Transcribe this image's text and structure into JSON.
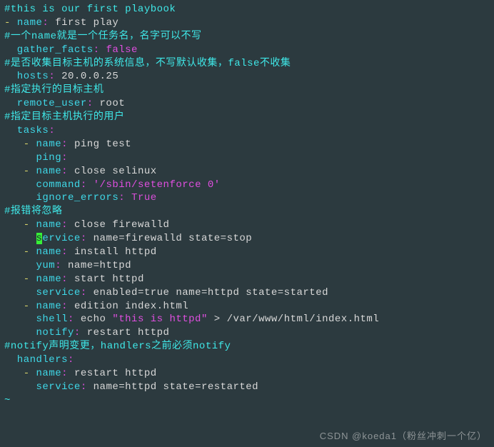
{
  "lines": {
    "l1": "#this is our first playbook",
    "l2a": "- ",
    "l2b": "name",
    "l2c": ": ",
    "l2d": "first play",
    "l3": "#一个name就是一个任务名，名字可以不写",
    "l4a": "  gather_facts",
    "l4b": ": ",
    "l4c": "false",
    "l5": "#是否收集目标主机的系统信息，不写默认收集，false不收集",
    "l6a": "  hosts",
    "l6b": ": ",
    "l6c": "20.0.0.25",
    "l7": "#指定执行的目标主机",
    "l8a": "  remote_user",
    "l8b": ": ",
    "l8c": "root",
    "l9": "#指定目标主机执行的用户",
    "l10a": "  tasks",
    "l10b": ":",
    "l11a": "   - ",
    "l11b": "name",
    "l11c": ": ",
    "l11d": "ping test",
    "l12a": "     ping",
    "l12b": ":",
    "l13a": "   - ",
    "l13b": "name",
    "l13c": ": ",
    "l13d": "close selinux",
    "l14a": "     command",
    "l14b": ": ",
    "l14c": "'/sbin/setenforce 0'",
    "l15a": "     ignore_errors",
    "l15b": ": ",
    "l15c": "True",
    "l16": "#报错将忽略",
    "l17a": "   - ",
    "l17b": "name",
    "l17c": ": ",
    "l17d": "close firewalld",
    "l18a": "     ",
    "l18cur": "s",
    "l18b": "ervice",
    "l18c": ": ",
    "l18d": "name=firewalld state=stop",
    "l19a": "   - ",
    "l19b": "name",
    "l19c": ": ",
    "l19d": "install httpd",
    "l20a": "     yum",
    "l20b": ": ",
    "l20c": "name=httpd",
    "l21a": "   - ",
    "l21b": "name",
    "l21c": ": ",
    "l21d": "start httpd",
    "l22a": "     service",
    "l22b": ": ",
    "l22c": "enabled=true name=httpd state=started",
    "l23a": "   - ",
    "l23b": "name",
    "l23c": ": ",
    "l23d": "edition index.html",
    "l24a": "     shell",
    "l24b": ": ",
    "l24c": "echo ",
    "l24d": "\"this is httpd\"",
    "l24e": " > /var/www/html/index.html",
    "l25a": "     notify",
    "l25b": ": ",
    "l25c": "restart httpd",
    "l26": "#notify声明变更，handlers之前必须notify",
    "l27a": "  handlers",
    "l27b": ":",
    "l28a": "   - ",
    "l28b": "name",
    "l28c": ": ",
    "l28d": "restart httpd",
    "l29a": "     service",
    "l29b": ": ",
    "l29c": "name=httpd state=restarted",
    "tilde": "~"
  },
  "watermark": "CSDN @koeda1（粉丝冲刺一个亿）",
  "chart_data": null
}
